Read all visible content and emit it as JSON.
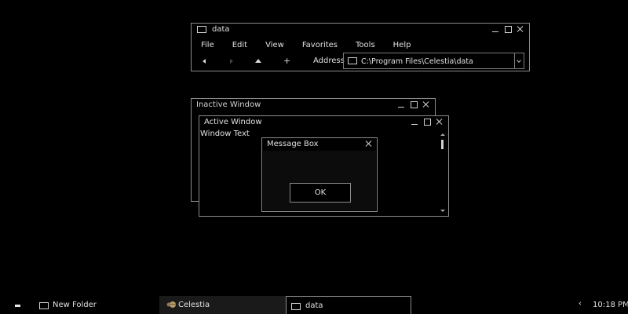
{
  "explorer": {
    "title": "data",
    "menu": [
      "File",
      "Edit",
      "View",
      "Favorites",
      "Tools",
      "Help"
    ],
    "address_label": "Address",
    "address_value": "C:\\Program Files\\Celestia\\data"
  },
  "inactive_window": {
    "title": "Inactive Window"
  },
  "active_window": {
    "title": "Active Window",
    "text": "Window Text"
  },
  "message_box": {
    "title": "Message Box",
    "ok_label": "OK"
  },
  "taskbar": {
    "items": [
      {
        "label": "New Folder",
        "icon": "window-icon"
      },
      {
        "label": "Celestia",
        "icon": "planet-icon"
      },
      {
        "label": "data",
        "icon": "window-icon",
        "active": true
      }
    ],
    "clock": "10:18 PM"
  },
  "colors": {
    "background": "#000000",
    "border": "#8c8c8c",
    "text": "#e0e0e0"
  }
}
